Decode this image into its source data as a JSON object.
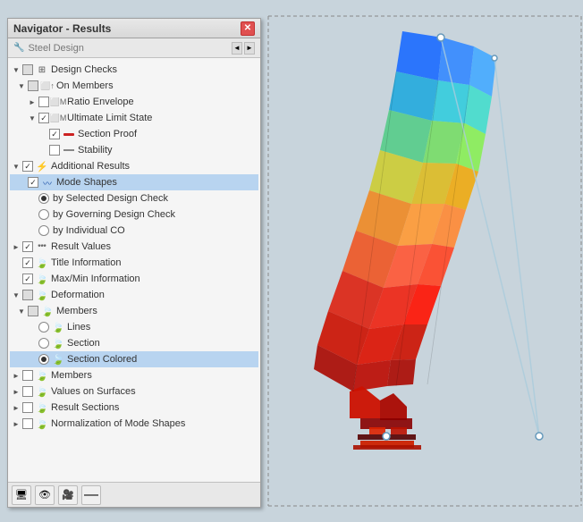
{
  "panel": {
    "title": "Navigator - Results",
    "close_label": "✕"
  },
  "steel_design": {
    "label": "Steel Design",
    "arrow_left": "◄",
    "arrow_right": "►"
  },
  "tree": {
    "items": [
      {
        "id": "design-checks",
        "level": 0,
        "expand": "▼",
        "checkbox": "partial",
        "icon": "checks",
        "label": "Design Checks"
      },
      {
        "id": "on-members",
        "level": 1,
        "expand": "▼",
        "checkbox": "partial",
        "icon": "members",
        "label": "On Members"
      },
      {
        "id": "ratio-envelope",
        "level": 2,
        "expand": "►",
        "checkbox": "unchecked",
        "icon": "ratio",
        "label": "Ratio Envelope"
      },
      {
        "id": "ultimate-limit",
        "level": 2,
        "expand": "▼",
        "checkbox": "checked",
        "icon": "uls",
        "label": "Ultimate Limit State"
      },
      {
        "id": "section-proof",
        "level": 3,
        "expand": "",
        "checkbox": "checked",
        "icon": "redline",
        "label": "Section Proof"
      },
      {
        "id": "stability",
        "level": 3,
        "expand": "",
        "checkbox": "unchecked",
        "icon": "dashline",
        "label": "Stability"
      },
      {
        "id": "additional-results",
        "level": 0,
        "expand": "▼",
        "checkbox": "checked",
        "icon": "additional",
        "label": "Additional Results"
      },
      {
        "id": "mode-shapes",
        "level": 1,
        "expand": "",
        "checkbox": "checked",
        "icon": "mode",
        "label": "Mode Shapes",
        "selected": true
      },
      {
        "id": "by-selected",
        "level": 2,
        "expand": "",
        "radio": "selected",
        "label": "by Selected Design Check"
      },
      {
        "id": "by-governing",
        "level": 2,
        "expand": "",
        "radio": "unselected",
        "label": "by Governing Design Check"
      },
      {
        "id": "by-individual",
        "level": 2,
        "expand": "",
        "radio": "unselected",
        "label": "by Individual CO"
      },
      {
        "id": "result-values",
        "level": 0,
        "expand": "►",
        "checkbox": "checked",
        "icon": "values",
        "label": "Result Values"
      },
      {
        "id": "title-information",
        "level": 0,
        "expand": "",
        "checkbox": "checked",
        "icon": "title",
        "label": "Title Information"
      },
      {
        "id": "maxmin-information",
        "level": 0,
        "expand": "",
        "checkbox": "checked",
        "icon": "maxmin",
        "label": "Max/Min Information"
      },
      {
        "id": "deformation",
        "level": 0,
        "expand": "▼",
        "checkbox": "partial",
        "icon": "deform",
        "label": "Deformation"
      },
      {
        "id": "def-members",
        "level": 1,
        "expand": "▼",
        "checkbox": "partial",
        "icon": "def-members",
        "label": "Members"
      },
      {
        "id": "lines",
        "level": 2,
        "expand": "",
        "radio": "unselected",
        "label": "Lines"
      },
      {
        "id": "section",
        "level": 2,
        "expand": "",
        "radio": "unselected",
        "label": "Section"
      },
      {
        "id": "section-colored",
        "level": 2,
        "expand": "",
        "radio": "selected",
        "label": "Section Colored",
        "selected": true
      },
      {
        "id": "members-top",
        "level": 0,
        "expand": "►",
        "checkbox": "unchecked",
        "icon": "members2",
        "label": "Members"
      },
      {
        "id": "values-on-surfaces",
        "level": 0,
        "expand": "►",
        "checkbox": "unchecked",
        "icon": "surfaces",
        "label": "Values on Surfaces"
      },
      {
        "id": "result-sections",
        "level": 0,
        "expand": "►",
        "checkbox": "unchecked",
        "icon": "sections",
        "label": "Result Sections"
      },
      {
        "id": "normalization",
        "level": 0,
        "expand": "►",
        "checkbox": "unchecked",
        "icon": "norm",
        "label": "Normalization of Mode Shapes"
      }
    ]
  },
  "bottom_toolbar": {
    "btn1": "🖥",
    "btn2": "👁",
    "btn3": "🎥",
    "btn4": "—"
  },
  "icons": {
    "checks": "☑",
    "members": "👥",
    "additional": "⚡",
    "mode": "〰",
    "values": "***",
    "title": "📄",
    "maxmin": "📊",
    "deform": "🔵",
    "def-members": "🔵"
  }
}
